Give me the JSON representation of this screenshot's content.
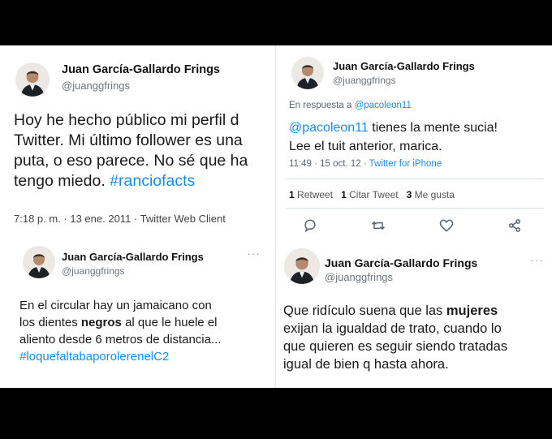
{
  "tweet1": {
    "name": "Juan García-Gallardo Frings",
    "handle": "@juanggfrings",
    "lines": [
      "Hoy he hecho público mi perfil d",
      "Twitter. Mi último follower es una",
      "puta, o eso parece. No sé que ha",
      "tengo miedo."
    ],
    "hashtag": "#ranciofacts",
    "meta": "7:18 p. m. · 13 ene. 2011 · Twitter Web Client"
  },
  "tweet2": {
    "name": "Juan García-Gallardo Frings",
    "handle": "@juanggfrings",
    "reply_prefix": "En respuesta a",
    "reply_to": "@pacoleon11",
    "mention": "@pacoleon11",
    "line1_rest": " tienes la mente sucia!",
    "line2": "Lee el tuit anterior, marica.",
    "meta_time": "11:49 · 15 oct. 12 · ",
    "meta_client": "Twitter for iPhone",
    "retweets_count": "1",
    "retweets_label": "Retweet",
    "quotes_count": "1",
    "quotes_label": "Citar Tweet",
    "likes_count": "3",
    "likes_label": "Me gusta",
    "actions": [
      "reply-icon",
      "retweet-icon",
      "like-icon",
      "share-icon"
    ]
  },
  "tweet3": {
    "name": "Juan García-Gallardo Frings",
    "handle": "@juanggfrings",
    "line1": "En el circular hay un jamaicano con",
    "line2_pre": "los dientes ",
    "line2_bold": "negros",
    "line2_post": " al que le huele el",
    "line3": "aliento desde 6 metros de distancia...",
    "hashtag": "#loquefaltabaporolerenelC2",
    "more": "···"
  },
  "tweet4": {
    "name": "Juan García-Gallardo Frings",
    "handle": "@juanggfrings",
    "line1_pre": "Que ridículo suena que las ",
    "line1_bold": "mujeres",
    "line2": "exijan la igualdad de trato, cuando lo",
    "line3": "que quieren es seguir siendo tratadas",
    "line4": "igual de bien q hasta ahora.",
    "more": "···"
  },
  "colors": {
    "link": "#1d8ce0",
    "text": "#1a1a1a",
    "secondary": "#6b7480",
    "frame": "#000000"
  }
}
